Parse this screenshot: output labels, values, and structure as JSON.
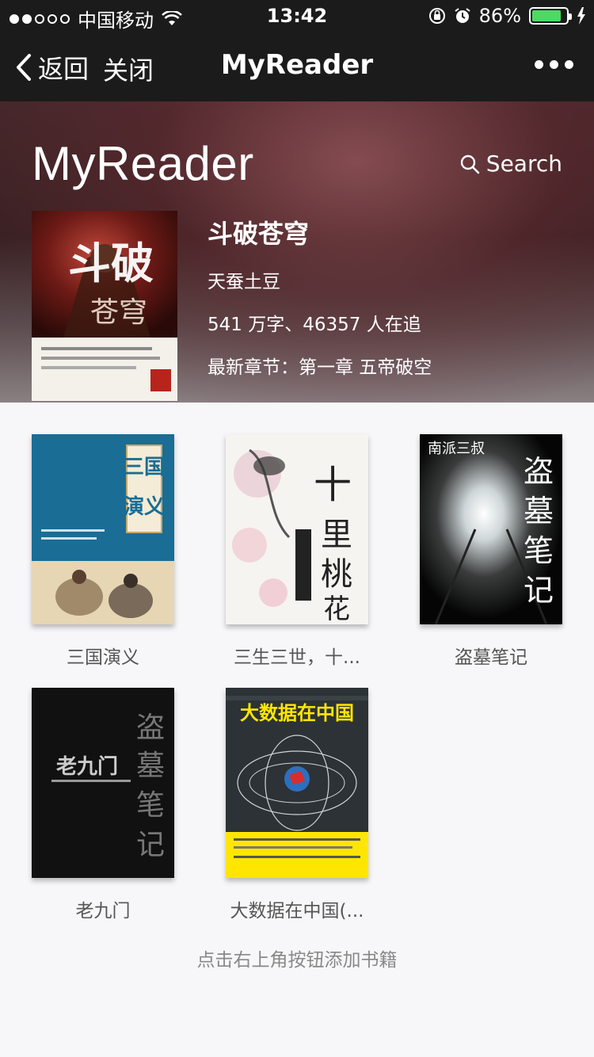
{
  "status": {
    "carrier": "中国移动",
    "time": "13:42",
    "battery": "86%",
    "battery_level": 0.86
  },
  "nav": {
    "back_label": "返回",
    "close_label": "关闭",
    "title": "MyReader"
  },
  "hero": {
    "brand": "MyReader",
    "search_label": "Search",
    "book": {
      "title": "斗破苍穹",
      "author": "天蚕土豆",
      "stats": "541 万字、46357 人在追",
      "latest": "最新章节：第一章 五帝破空",
      "cover_text": "斗破苍穹"
    }
  },
  "books": [
    {
      "title": "三国演义",
      "cover_text": "三国演义"
    },
    {
      "title": "三生三世，十...",
      "cover_text": "十里桃花"
    },
    {
      "title": "盗墓笔记",
      "cover_text": "盗墓笔记"
    },
    {
      "title": "老九门",
      "cover_text": "老九门"
    },
    {
      "title": "大数据在中国(...",
      "cover_text": "大数据在中国"
    }
  ],
  "footer_hint": "点击右上角按钮添加书籍",
  "colors": {
    "bar_bg": "#1b1b1b",
    "battery_green": "#4cd964",
    "page_bg": "#f7f7f9"
  }
}
